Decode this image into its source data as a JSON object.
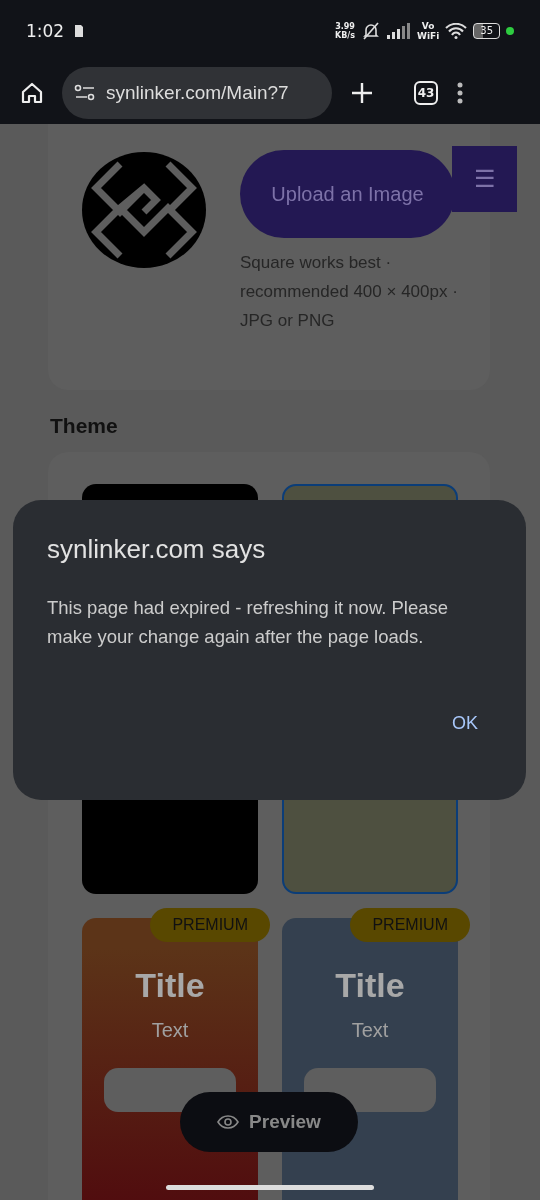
{
  "status_bar": {
    "time": "1:02",
    "net_speed_value": "3.99",
    "net_speed_unit": "KB/s",
    "vowifi_top": "Vo",
    "vowifi_bottom": "WiFi",
    "battery": "35"
  },
  "browser": {
    "url": "synlinker.com/Main?7",
    "tab_count": "43"
  },
  "profile": {
    "upload_button": "Upload an Image",
    "menu_icon": "☰",
    "hint": "Square works best · recommended 400 × 400px · JPG or PNG"
  },
  "theme": {
    "heading": "Theme",
    "tiles": [
      {
        "kind": "plain",
        "color": "#000000",
        "selected": false
      },
      {
        "kind": "plain",
        "color": "#4e5040",
        "selected": true
      },
      {
        "kind": "sample",
        "color": "#5c3418",
        "selected": false,
        "badge": "PREMIUM",
        "title": "Title",
        "text": "Text"
      },
      {
        "kind": "sample",
        "color": "#34404f",
        "selected": false,
        "badge": "PREMIUM",
        "title": "Title",
        "text": "Text"
      }
    ]
  },
  "preview_button": "Preview",
  "dialog": {
    "title": "synlinker.com says",
    "message": "This page had expired - refreshing it now. Please make your change again after the page loads.",
    "button": "OK"
  }
}
